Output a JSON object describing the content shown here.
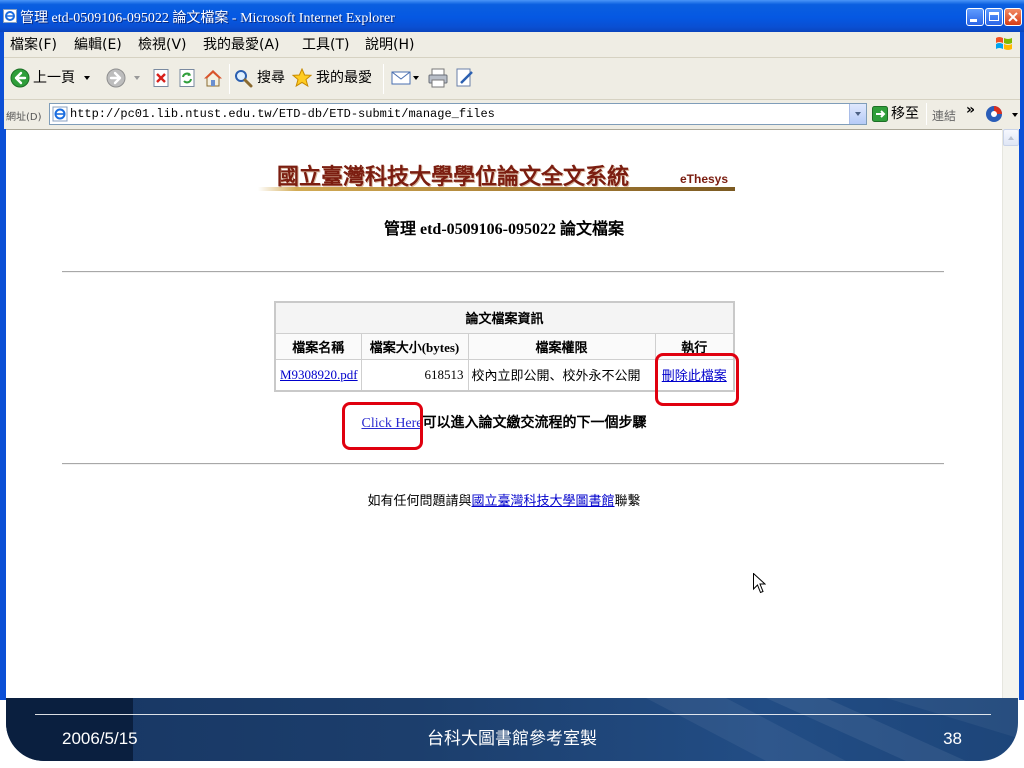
{
  "window": {
    "title": "管理 etd-0509106-095022 論文檔案 - Microsoft Internet Explorer",
    "icon": "ie-page-icon",
    "controls": [
      "minimize-icon",
      "maximize-icon",
      "close-icon"
    ]
  },
  "menu": {
    "items": [
      "檔案(F)",
      "編輯(E)",
      "檢視(V)",
      "我的最愛(A)",
      "工具(T)",
      "說明(H)"
    ],
    "logo_icon": "windows-flag-icon"
  },
  "toolbar": {
    "back_label": "上一頁",
    "search_label": "搜尋",
    "favorites_label": "我的最愛",
    "icons": [
      "back-icon",
      "forward-icon",
      "stop-icon",
      "refresh-icon",
      "home-icon",
      "search-icon",
      "favorites-icon",
      "mail-icon",
      "print-icon",
      "edit-icon"
    ]
  },
  "address": {
    "label": "網址(D)",
    "url": "http://pc01.lib.ntust.edu.tw/ETD-db/ETD-submit/manage_files",
    "go_label": "移至",
    "links_label": "連結",
    "more_label": "»"
  },
  "page": {
    "logo_title": "國立臺灣科技大學學位論文全文系統",
    "logo_brand": "eThesys",
    "heading": "管理 etd-0509106-095022 論文檔案",
    "table": {
      "caption": "論文檔案資訊",
      "headers": [
        "檔案名稱",
        "檔案大小(bytes)",
        "檔案權限",
        "執行"
      ],
      "rows": [
        [
          "M9308920.pdf",
          "618513",
          "校內立即公開、校外永不公開",
          "刪除此檔案"
        ]
      ]
    },
    "next_step": {
      "link": "Click Here",
      "text": "可以進入論文繳交流程的下一個步驟"
    },
    "contact": {
      "prefix": "如有任何問題請與",
      "link": "國立臺灣科技大學圖書館",
      "suffix": "聯繫"
    }
  },
  "slide_footer": {
    "date": "2006/5/15",
    "credit": "台科大圖書館參考室製",
    "page_number": "38"
  },
  "colors": {
    "title_bar": "#0a5fe0",
    "toolbar_bg": "#efede4",
    "logo": "#7b1d10",
    "link": "#0000cc",
    "click_link": "#2a2ad0",
    "highlight": "#e0000f",
    "footer_bg": "#1c3e6c",
    "footer_dark": "#0a1f3f"
  }
}
